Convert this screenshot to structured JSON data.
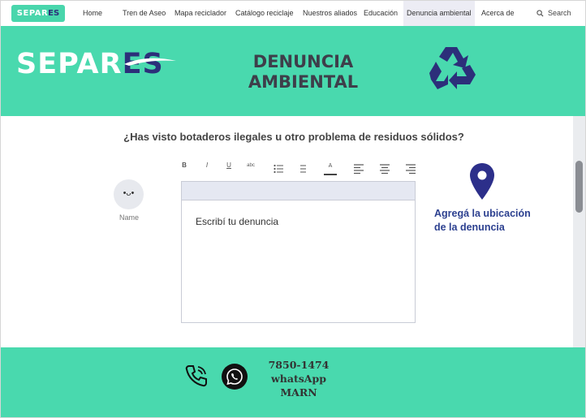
{
  "nav": {
    "logo_main": "SEPAR",
    "logo_accent": "ES",
    "items": [
      {
        "label": "Home"
      },
      {
        "label": "Tren de Aseo"
      },
      {
        "label": "Mapa reciclador"
      },
      {
        "label": "Catálogo reciclaje"
      },
      {
        "label": "Nuestros aliados"
      },
      {
        "label": "Educación"
      },
      {
        "label": "Denuncia ambiental",
        "active": true
      },
      {
        "label": "Acerca de"
      }
    ],
    "search_label": "Search",
    "search_icon": "search-icon"
  },
  "hero": {
    "logo_main": "SEPAR",
    "logo_accent": "ES",
    "title_line1": "DENUNCIA",
    "title_line2": "AMBIENTAL",
    "icon": "recycle-icon"
  },
  "form": {
    "question": "¿Has visto botaderos ilegales u otro problema de residuos sólidos?",
    "avatar_face": "•ᴗ•",
    "avatar_name": "Name",
    "toolbar": {
      "bold": "B",
      "italic": "I",
      "underline": "U",
      "strike": "abc",
      "color": "A"
    },
    "editor_placeholder": "Escribí tu denuncia",
    "location_label": "Agregá la ubicación de la denuncia"
  },
  "footer": {
    "phone": "7850-1474",
    "whatsapp": "whatsApp",
    "org": "MARN"
  },
  "colors": {
    "brand_green": "#49d9ae",
    "brand_navy": "#2c2f7a",
    "location_blue": "#2d4190"
  }
}
